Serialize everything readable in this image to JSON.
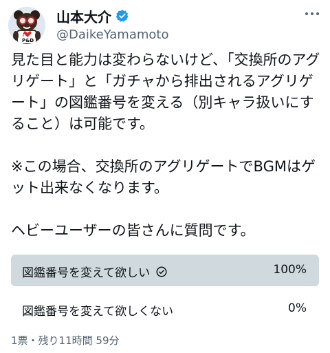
{
  "author": {
    "display_name": "山本大介",
    "handle": "@DaikeYamamoto",
    "verified": true,
    "avatar_icon": "bear-mascot-avatar",
    "avatar_text": "I ♥ P&D"
  },
  "tweet": {
    "text": "見た目と能力は変わらないけど、「交換所のアグリゲート」と「ガチャから排出されるアグリゲート」の図鑑番号を変える（別キャラ扱いにすること）は可能です。\n\n※この場合、交換所のアグリゲートでBGMはゲット出来なくなります。\n\nヘビーユーザーの皆さんに質問です。"
  },
  "poll": {
    "options": [
      {
        "label": "図鑑番号を変えて欲しい",
        "percent_text": "100%",
        "fraction": 1.0,
        "selected": true
      },
      {
        "label": "図鑑番号を変えて欲しくない",
        "percent_text": "0%",
        "fraction": 0.0,
        "selected": false
      }
    ],
    "meta": "1票・残り11時間 59分"
  },
  "colors": {
    "text": "#0f1419",
    "secondary": "#536471",
    "poll_bar": "#cfd9de",
    "verified": "#1d9bf0"
  }
}
